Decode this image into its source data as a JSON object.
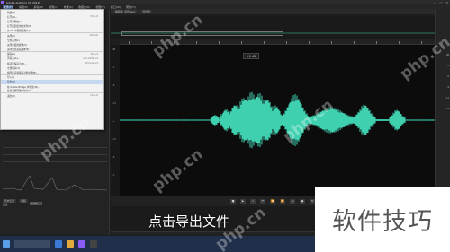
{
  "window": {
    "title": "Adobe Audition CC 2018",
    "controls": [
      "—",
      "□",
      "✕"
    ]
  },
  "menubar": {
    "items": [
      "文件(F)",
      "编辑(E)",
      "多轨(M)",
      "剪辑(C)",
      "效果(S)",
      "收藏夹(R)",
      "视图(V)",
      "窗口(W)",
      "帮助(H)"
    ]
  },
  "file_menu": {
    "items": [
      {
        "label": "新建(N)",
        "key": ""
      },
      {
        "label": "打开(O)...",
        "key": "Ctrl+O"
      },
      {
        "label": "打开并附加(A)",
        "key": ""
      },
      {
        "label": "打开最近使用的文件(R)",
        "key": ""
      },
      {
        "label": "从 CD 中提取音频(E)...",
        "key": ""
      },
      {
        "label": "关闭(C)",
        "key": "Ctrl+W"
      },
      {
        "label": "全部关闭(L)",
        "key": ""
      },
      {
        "label": "关闭未使用媒体(U)",
        "key": ""
      },
      {
        "label": "关闭会话及其媒体(S)",
        "key": ""
      },
      {
        "label": "保存(S)",
        "key": "Ctrl+S"
      },
      {
        "label": "另存为(A)...",
        "key": "Ctrl+Shift+S"
      },
      {
        "label": "将选区保存为(E)...",
        "key": "Ctrl+Alt+S"
      },
      {
        "label": "全部保存(V)",
        "key": ""
      },
      {
        "label": "将所有音频保存为批处理(B)...",
        "key": ""
      },
      {
        "label": "导入(I)",
        "key": ""
      },
      {
        "label": "导出(E)",
        "key": ""
      },
      {
        "label": "在 Adobe Bridge 中浏览(W)...",
        "key": ""
      },
      {
        "label": "在资源管理器中显示(X)",
        "key": ""
      },
      {
        "label": "退出(X)",
        "key": "Ctrl+Q"
      }
    ],
    "highlighted_index": 15
  },
  "left_panel": {
    "tab_history": "历史记录",
    "tab_video": "视频",
    "zoom_label": "缩放",
    "zoom_value": "100%"
  },
  "editor": {
    "tabs": [
      "编辑器: 录音.wav",
      "混音器"
    ],
    "hud_volume": "+0 dB",
    "db_labels": [
      "dB",
      "-3",
      "-6",
      "-12",
      "-∞",
      "-12",
      "-6",
      "-3"
    ]
  },
  "transport": {
    "buttons": [
      "■",
      "▶",
      "⏸",
      "⏮",
      "⏪",
      "⏩",
      "⏭",
      "●",
      "⟲"
    ]
  },
  "right_panel": {
    "values": [
      "dB",
      "-3",
      "-6",
      "-9",
      "-12",
      "-18"
    ]
  },
  "subtitle": "点击导出文件",
  "banner": "软件技巧",
  "watermarks": [
    "php.cn",
    "php.cn",
    "php.cn",
    "php.cn",
    "php.cn",
    "php.cn"
  ],
  "taskbar": {
    "clock": "17:35"
  },
  "colors": {
    "waveform": "#3fd0b0",
    "menu_highlight": "#c6d9f0"
  },
  "icons": {
    "app": "audition-icon",
    "start": "windows-start-icon"
  }
}
